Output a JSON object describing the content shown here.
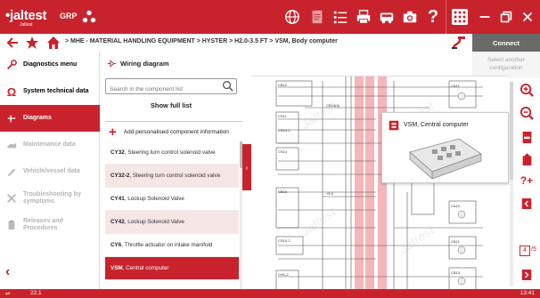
{
  "app": {
    "logo_text": "•jaltest",
    "logo_sub": "Jaltest",
    "grp_label": "GRP",
    "toolbar_icons": [
      "network-icon",
      "globe-icon",
      "document-icon",
      "list-icon",
      "print-icon",
      "truck-icon",
      "camera-icon",
      "help-icon",
      "grid-icon",
      "minimize-icon",
      "restore-icon",
      "close-icon"
    ]
  },
  "nav": {
    "breadcrumb": "> MHE - MATERIAL HANDLING EQUIPMENT > HYSTER > H2.0-3.5 FT > VSM, Body computer",
    "connect_label": "Connect",
    "select_another": "Select another configuration"
  },
  "sidebar": {
    "items": [
      {
        "label": "Diagnostics menu",
        "icon": "wrench-icon",
        "state": "normal"
      },
      {
        "label": "System technical data",
        "icon": "omega-icon",
        "state": "normal"
      },
      {
        "label": "Diagrams",
        "icon": "diagram-icon",
        "state": "active"
      },
      {
        "label": "Maintenance data",
        "icon": "oilcan-icon",
        "state": "disabled"
      },
      {
        "label": "Vehicle/vessel data",
        "icon": "gauge-icon",
        "state": "disabled"
      },
      {
        "label": "Troubleshooting by symptoms",
        "icon": "tools-icon",
        "state": "disabled"
      },
      {
        "label": "Releases and Procedures",
        "icon": "clipboard-icon",
        "state": "disabled"
      }
    ]
  },
  "panel": {
    "title": "Wiring diagram",
    "search_placeholder": "Search in the component list",
    "show_full_label": "Show full list",
    "add_label": "Add personalised component information",
    "components": [
      {
        "code": "CY32",
        "desc": ", Steering turn control solenoid valve"
      },
      {
        "code": "CY32-2",
        "desc": ", Steering turn control solenoid valve"
      },
      {
        "code": "CY41",
        "desc": ", Lockup Solenoid Valve"
      },
      {
        "code": "CY42",
        "desc": ", Lockup Solenoid Valve"
      },
      {
        "code": "CY6",
        "desc": ", Throttle actuator on intake manifold"
      },
      {
        "code": "VSM",
        "desc": ", Central computer"
      }
    ]
  },
  "diagram": {
    "tooltip_title": "VSM, Central computer",
    "labels": {
      "ca11": "CA11",
      "cb12": "CB12",
      "cb14a": "CB14(A)",
      "cs11": "CS11",
      "cs13_2": "CS13-2",
      "cs14": "CS14",
      "cb10": "CB10",
      "cs10_2": "CS10-2",
      "ca10": "CA10",
      "cb11": "CB11",
      "cb13": "CB13",
      "ch1_2": "CH1-2",
      "v5": "+5 V"
    },
    "highlight_color": "#f4b6b8"
  },
  "viewer": {
    "page_current": "4",
    "page_total": "/5"
  },
  "status": {
    "usb": "⇌",
    "version": "22.1",
    "time": "13:41"
  }
}
